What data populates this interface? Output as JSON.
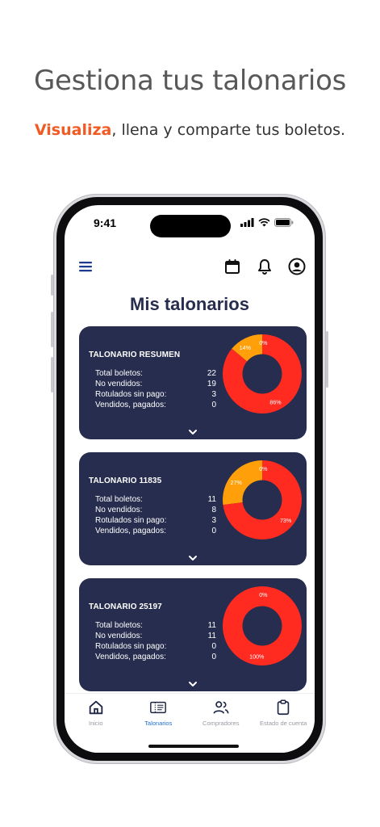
{
  "promo": {
    "title": "Gestiona tus talonarios",
    "subtitle_highlight": "Visualiza",
    "subtitle_rest": ", llena y comparte tus boletos."
  },
  "status_bar": {
    "time": "9:41"
  },
  "page": {
    "title": "Mis talonarios"
  },
  "stat_labels": {
    "total": "Total boletos:",
    "no_vendidos": "No vendidos:",
    "rotulados": "Rotulados sin pago:",
    "vendidos": "Vendidos, pagados:"
  },
  "cards": [
    {
      "title": "TALONARIO RESUMEN",
      "total": "22",
      "no_vendidos": "19",
      "rotulados": "3",
      "vendidos": "0",
      "chart": {
        "red_pct": 86,
        "orange_pct": 14,
        "green_pct": 0,
        "labels": {
          "red": "86%",
          "orange": "14%",
          "green": "0%"
        }
      }
    },
    {
      "title": "TALONARIO 11835",
      "total": "11",
      "no_vendidos": "8",
      "rotulados": "3",
      "vendidos": "0",
      "chart": {
        "red_pct": 73,
        "orange_pct": 27,
        "green_pct": 0,
        "labels": {
          "red": "73%",
          "orange": "27%",
          "green": "0%"
        }
      }
    },
    {
      "title": "TALONARIO 25197",
      "total": "11",
      "no_vendidos": "11",
      "rotulados": "0",
      "vendidos": "0",
      "chart": {
        "red_pct": 100,
        "orange_pct": 0,
        "green_pct": 0,
        "labels": {
          "red": "100%",
          "orange": "",
          "green": "0%"
        }
      }
    }
  ],
  "chart_colors": {
    "red": "#ff2b20",
    "orange": "#ff9f0a",
    "hole": "#272d4e"
  },
  "nav": [
    {
      "label": "Inicio",
      "icon": "home-icon",
      "active": false
    },
    {
      "label": "Talonarios",
      "icon": "ticket-book-icon",
      "active": true
    },
    {
      "label": "Compradores",
      "icon": "users-icon",
      "active": false
    },
    {
      "label": "Estado de cuenta",
      "icon": "clipboard-icon",
      "active": false
    }
  ]
}
